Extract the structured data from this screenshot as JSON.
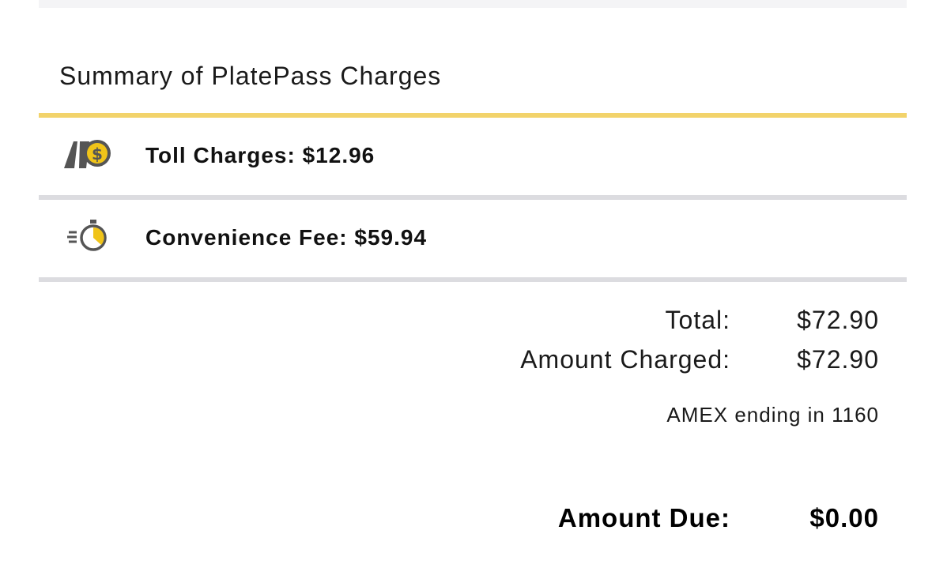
{
  "summary": {
    "title": "Summary of PlatePass Charges",
    "charges": [
      {
        "icon": "toll-road-dollar-icon",
        "label": "Toll Charges: $12.96"
      },
      {
        "icon": "stopwatch-speed-icon",
        "label": "Convenience Fee: $59.94"
      }
    ],
    "totals": {
      "total_label": "Total:",
      "total_value": "$72.90",
      "charged_label": "Amount Charged:",
      "charged_value": "$72.90",
      "card_info": "AMEX ending in 1160",
      "due_label": "Amount Due:",
      "due_value": "$0.00"
    }
  },
  "colors": {
    "accent_rule": "#f2d36b",
    "divider": "#dcdce0",
    "icon_gold": "#f0c419",
    "icon_gray": "#555555"
  }
}
